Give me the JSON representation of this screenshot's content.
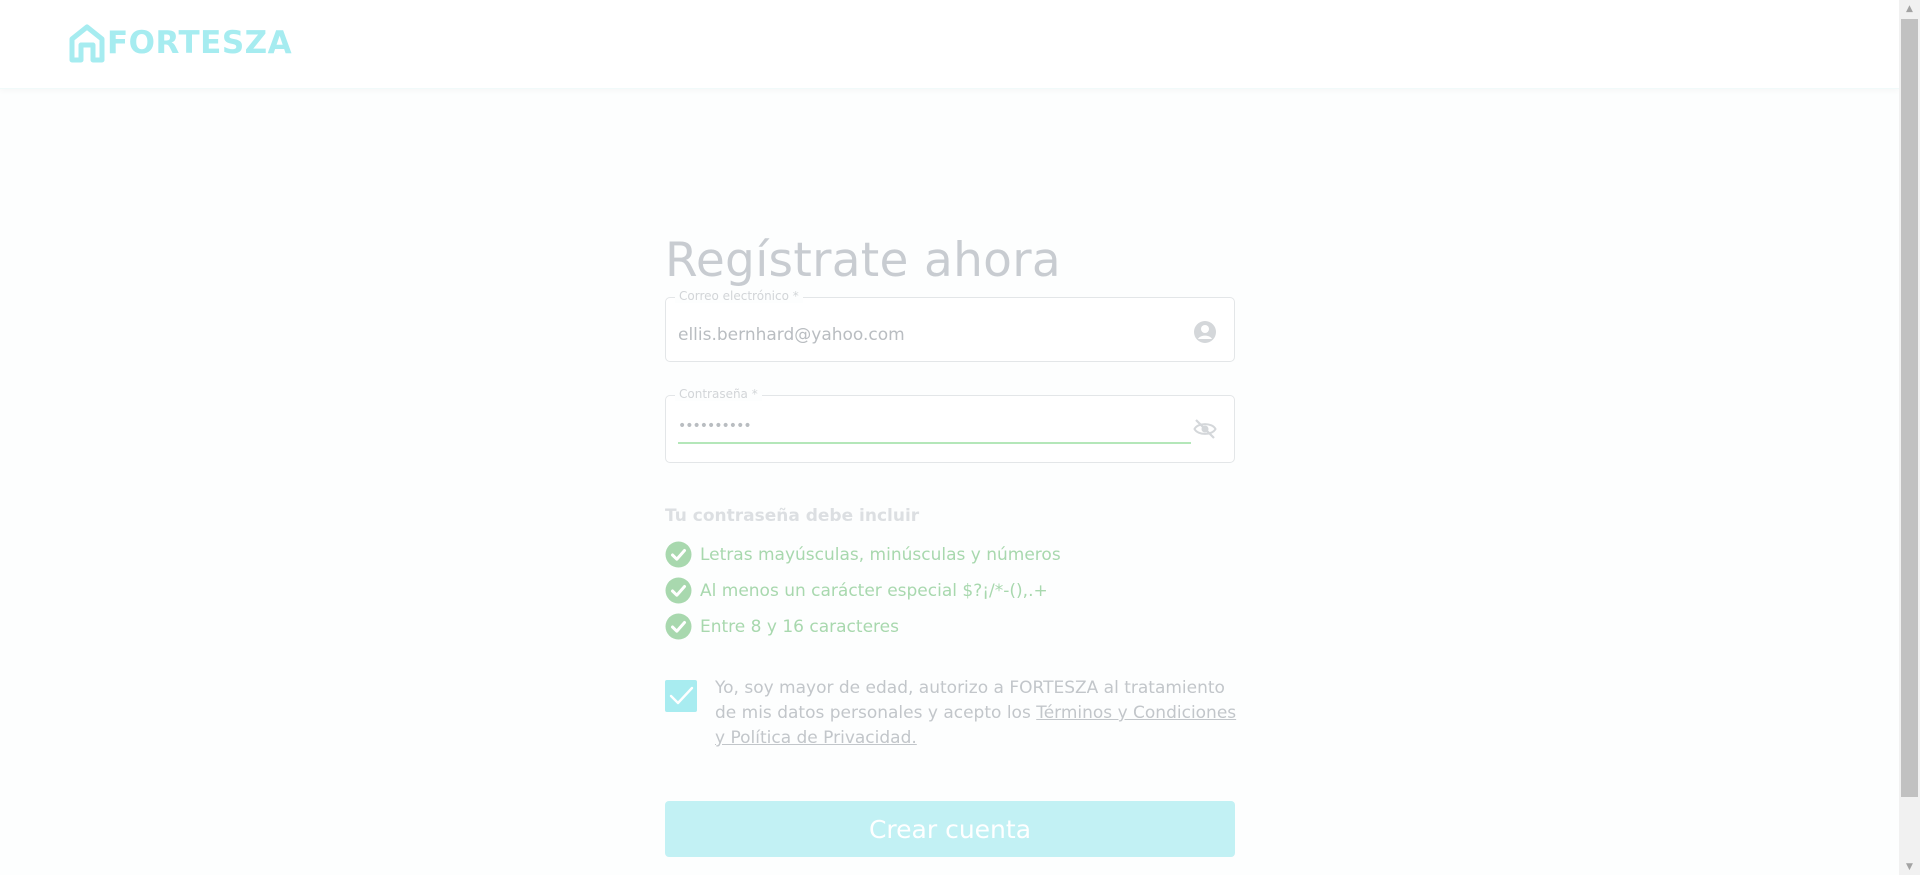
{
  "header": {
    "brand": "FORTESZA"
  },
  "register": {
    "title": "Regístrate ahora",
    "email": {
      "label": "Correo electrónico *",
      "value": "ellis.bernhard@yahoo.com"
    },
    "password": {
      "label": "Contraseña *",
      "value": "••••••••••"
    },
    "requirements_title": "Tu contraseña debe incluir",
    "requirements": [
      "Letras mayúsculas, minúsculas y números",
      "Al menos un carácter especial $?¡/*-(),.+",
      "Entre 8 y 16 caracteres"
    ],
    "terms": {
      "text_line1": "Yo, soy mayor de edad, autorizo a FORTESZA al tratamiento de mis datos personales y acepto los",
      "link": "Términos y Condiciones y Política de Privacidad.",
      "checked": true
    },
    "submit_label": "Crear cuenta"
  },
  "icons": {
    "logo": "house-logo-icon",
    "email_field": "user-circle-icon",
    "password_field": "eye-off-icon",
    "requirement": "check-circle-icon",
    "checkbox": "check-icon"
  },
  "colors": {
    "brand": "#a6ecf0",
    "success": "#a8d8ae",
    "button": "#c2f1f4"
  }
}
